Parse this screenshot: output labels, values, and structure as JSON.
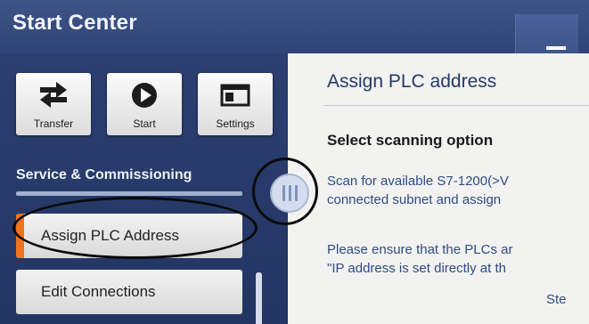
{
  "header": {
    "title": "Start Center",
    "minimize_icon": "minimize-icon"
  },
  "toolbar": {
    "tiles": [
      {
        "label": "Transfer",
        "icon": "transfer-arrows-icon"
      },
      {
        "label": "Start",
        "icon": "play-icon"
      },
      {
        "label": "Settings",
        "icon": "settings-window-icon"
      }
    ]
  },
  "sidebar": {
    "section_title": "Service & Commissioning",
    "items": [
      {
        "label": "Assign PLC Address",
        "active": true
      },
      {
        "label": "Edit Connections",
        "active": false
      }
    ]
  },
  "dialog": {
    "title": "Assign PLC address",
    "subtitle": "Select scanning option",
    "paragraph1": [
      "Scan for available S7-1200(>V",
      "connected subnet and assign"
    ],
    "paragraph2": [
      "Please ensure that the PLCs ar",
      "\"IP address is set directly at th"
    ],
    "tail": "Ste"
  },
  "colors": {
    "accent": "#f0731e",
    "panel": "#2c3f70",
    "dialog_text": "#2f4c82"
  }
}
